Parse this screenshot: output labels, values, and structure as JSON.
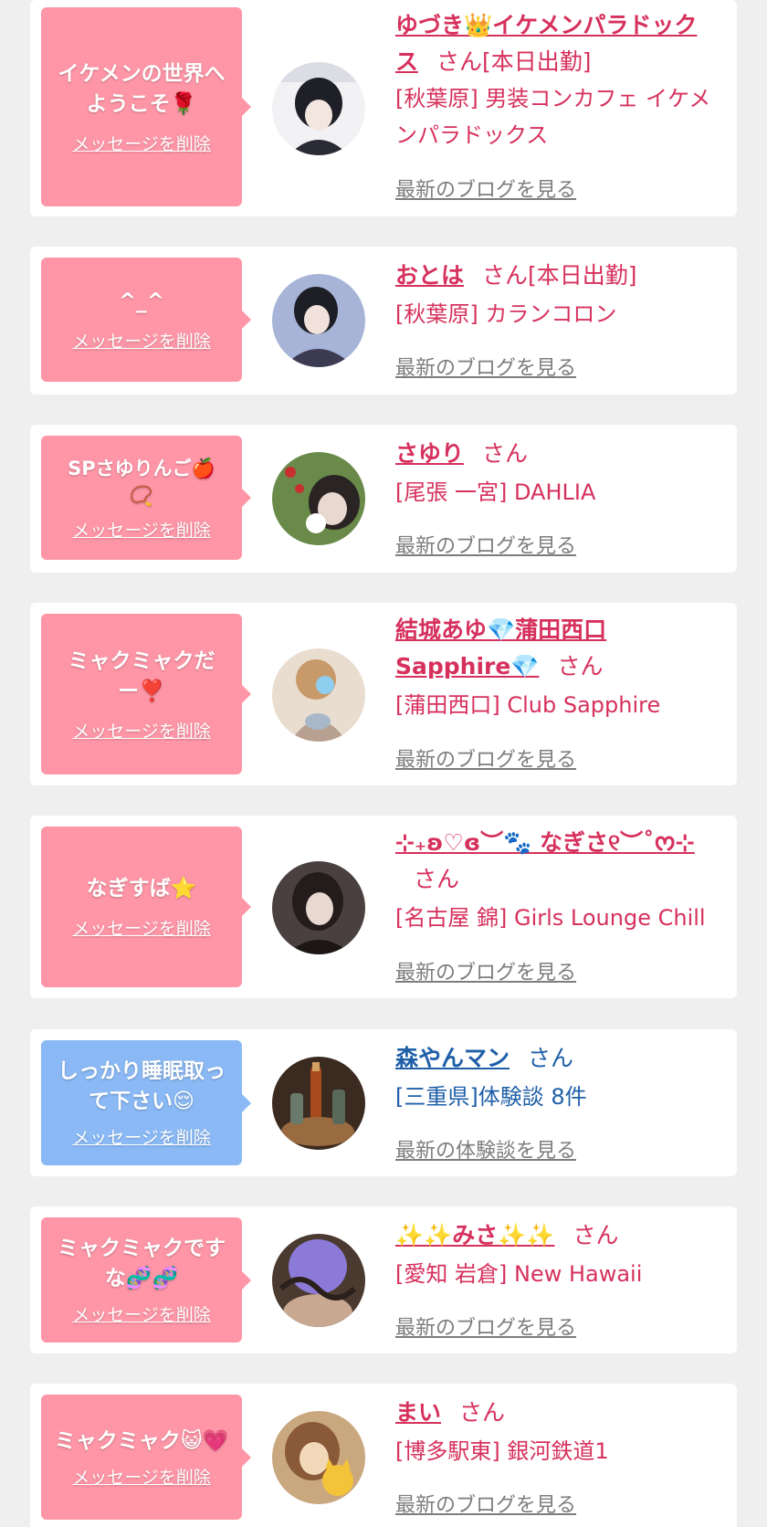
{
  "cards": [
    {
      "message_line1": "イケメンの世界へ",
      "message_line2": "ようこそ🌹",
      "delete_label": "メッセージを削除",
      "name": "ゆづき👑イケメンパラドックス",
      "honorific": "さん[本日出勤]",
      "shop": "[秋葉原] 男装コンカフェ イケメンパラドックス",
      "blog_link": "最新のブログを見る",
      "avatar_colors": [
        "#f2f2f4",
        "#2a2a34"
      ]
    },
    {
      "message_line1": "^_^",
      "delete_label": "メッセージを削除",
      "name": "おとは",
      "honorific": "さん[本日出勤]",
      "shop": "[秋葉原] カランコロン",
      "blog_link": "最新のブログを見る",
      "avatar_colors": [
        "#a7b4d8",
        "#3d3b52"
      ]
    },
    {
      "message_line1": "SPさゆりんご🍎",
      "message_line2": "📿",
      "delete_label": "メッセージを削除",
      "name": "さゆり",
      "honorific": "さん",
      "shop": "[尾張 一宮] DAHLIA",
      "blog_link": "最新のブログを見る",
      "avatar_colors": [
        "#6a8a4a",
        "#d8c8c0"
      ]
    },
    {
      "message_line1": "ミャクミャクだ",
      "message_line2": "ー❣️",
      "delete_label": "メッセージを削除",
      "name": "結城あゆ💎蒲田西口Sapphire💎",
      "honorific": "さん",
      "shop": "[蒲田西口] Club Sapphire",
      "blog_link": "最新のブログを見る",
      "avatar_colors": [
        "#e9ddd0",
        "#b8a090"
      ]
    },
    {
      "message_line1": "なぎすば⭐",
      "delete_label": "メッセージを削除",
      "name": "⊹₊ʚ♡ɞ︶🐾 なぎさ୧︶˚ᰔ⊹",
      "honorific": "さん",
      "shop": "[名古屋 錦] Girls Lounge Chill",
      "blog_link": "最新のブログを見る",
      "avatar_colors": [
        "#4a4040",
        "#e8d8d0"
      ]
    },
    {
      "message_line1": "しっかり睡眠取っ",
      "message_line2": "て下さい😌",
      "delete_label": "メッセージを削除",
      "name": "森やんマン",
      "honorific": "さん",
      "shop": "[三重県]体験談 8件",
      "blog_link": "最新の体験談を見る",
      "avatar_colors": [
        "#3a2a20",
        "#9a6a40"
      ]
    },
    {
      "message_line1": "ミャクミャクです",
      "message_line2": "な🧬🧬",
      "delete_label": "メッセージを削除",
      "name": "✨✨みさ✨✨",
      "honorific": "さん",
      "shop": "[愛知 岩倉] New Hawaii",
      "blog_link": "最新のブログを見る",
      "avatar_colors": [
        "#8c7ad8",
        "#4a3a30"
      ]
    },
    {
      "message_line1": "ミャクミャク😺💗",
      "delete_label": "メッセージを削除",
      "name": "まい",
      "honorific": "さん",
      "shop": "[博多駅東] 銀河鉄道1",
      "blog_link": "最新のブログを見る",
      "avatar_colors": [
        "#c9a880",
        "#f0d8b8"
      ]
    }
  ]
}
